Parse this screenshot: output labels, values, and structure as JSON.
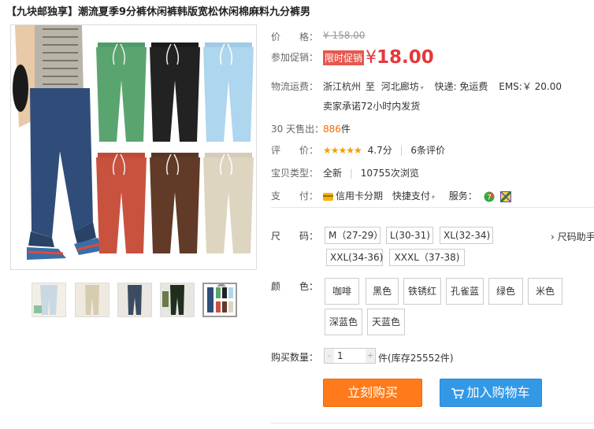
{
  "title": "【九块邮独享】潮流夏季9分裤休闲裤韩版宽松休闲棉麻料九分裤男",
  "price_row": {
    "label": "价　　格：",
    "original": "¥ 158.00"
  },
  "promo_row": {
    "label": "参加促销：",
    "tag": "限时促销",
    "yen": "¥",
    "price": "18.00"
  },
  "shipping_row": {
    "label": "物流运费：",
    "from": "浙江杭州",
    "to_prefix": "至",
    "to": "河北廊坊",
    "express": "快递: 免运费",
    "ems": "EMS:￥ 20.00",
    "promise": "卖家承诺72小时内发货"
  },
  "sales_row": {
    "label": "30 天售出：",
    "count": "886",
    "unit": "件"
  },
  "rating_row": {
    "label": "评　　价：",
    "stars": "★★★★★",
    "score": "4.7分",
    "reviews": "6条评价"
  },
  "type_row": {
    "label": "宝贝类型：",
    "type": "全新",
    "views": "10755次浏览"
  },
  "payment_row": {
    "label": "支　　付：",
    "credit": "信用卡分期",
    "quick": "快捷支付",
    "service": "服务："
  },
  "size": {
    "label": "尺　　码：",
    "helper": "尺码助手",
    "options": [
      "M（27-29）",
      "L(30-31)",
      "XL(32-34)",
      "XXL(34-36)",
      "XXXL（37-38)"
    ]
  },
  "color": {
    "label": "颜　　色：",
    "options": [
      "咖啡",
      "黑色",
      "铁锈红",
      "孔雀蓝",
      "绿色",
      "米色",
      "深蓝色",
      "天蓝色"
    ]
  },
  "quantity": {
    "label": "购买数量：",
    "value": "1",
    "minus": "-",
    "plus": "+",
    "unit": "件",
    "stock": "(库存25552件)"
  },
  "buttons": {
    "buy_now": "立刻购买",
    "add_to_cart": "加入购物车"
  },
  "colors": {
    "price_red": "#e4393c",
    "buy_orange": "#ff7a1a",
    "cart_blue": "#3399e6"
  }
}
